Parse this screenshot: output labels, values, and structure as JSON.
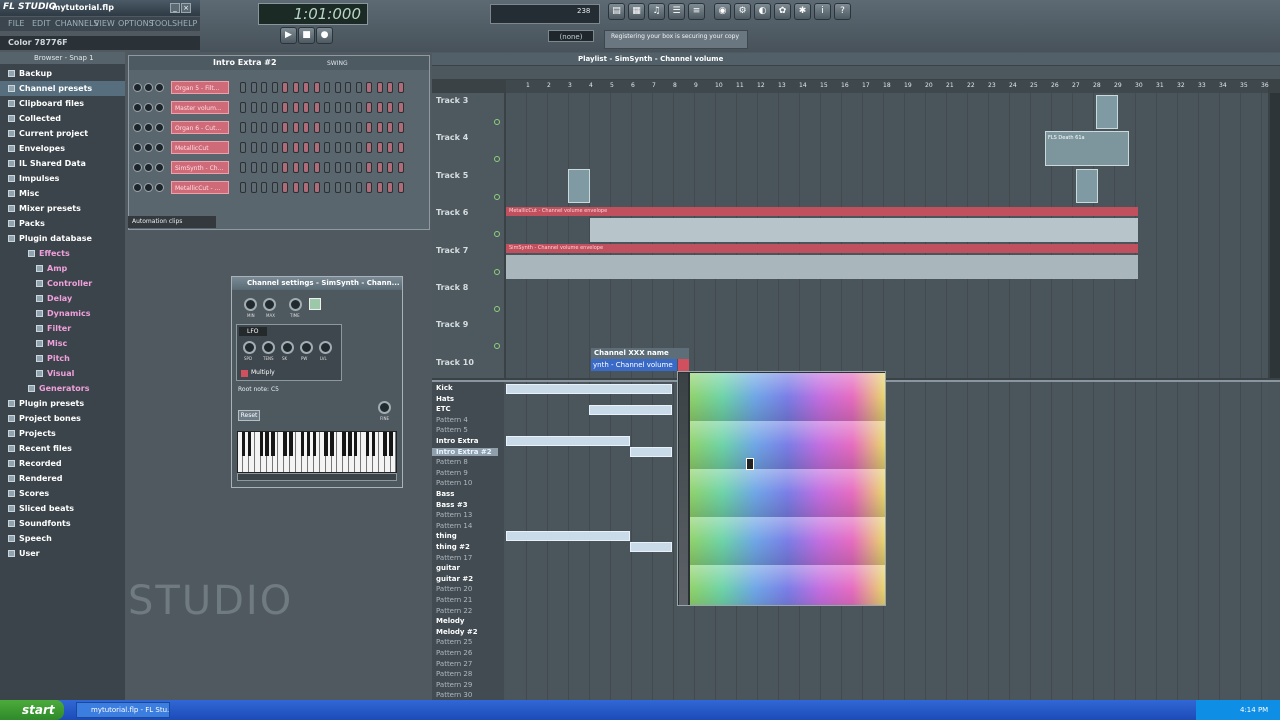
{
  "app": {
    "logo": "FL STUDIO",
    "file_name": "mytutorial.flp",
    "taskbar_task": "mytutorial.flp - FL Stu...",
    "clock": "4:14 PM",
    "start_label": "start"
  },
  "menu": [
    "FILE",
    "EDIT",
    "CHANNELS",
    "VIEW",
    "OPTIONS",
    "TOOLS",
    "HELP"
  ],
  "hint": "Color 78776F",
  "transport": {
    "time": "1:01:000",
    "pattern_select": "(none)",
    "notice": "Registering your box is securing your copy",
    "tempo": "238"
  },
  "browser": {
    "title": "Browser - Snap 1",
    "items": [
      {
        "label": "Backup",
        "sub": false
      },
      {
        "label": "Channel presets",
        "sub": false,
        "selected": true
      },
      {
        "label": "Clipboard files",
        "sub": false
      },
      {
        "label": "Collected",
        "sub": false
      },
      {
        "label": "Current project",
        "sub": false
      },
      {
        "label": "Envelopes",
        "sub": false
      },
      {
        "label": "IL Shared Data",
        "sub": false
      },
      {
        "label": "Impulses",
        "sub": false
      },
      {
        "label": "Misc",
        "sub": false
      },
      {
        "label": "Mixer presets",
        "sub": false
      },
      {
        "label": "Packs",
        "sub": false
      },
      {
        "label": "Plugin database",
        "sub": false
      },
      {
        "label": "Effects",
        "sub": true,
        "level": 1
      },
      {
        "label": "Amp",
        "sub": true,
        "level": 2
      },
      {
        "label": "Controller",
        "sub": true,
        "level": 2
      },
      {
        "label": "Delay",
        "sub": true,
        "level": 2
      },
      {
        "label": "Dynamics",
        "sub": true,
        "level": 2
      },
      {
        "label": "Filter",
        "sub": true,
        "level": 2
      },
      {
        "label": "Misc",
        "sub": true,
        "level": 2
      },
      {
        "label": "Pitch",
        "sub": true,
        "level": 2
      },
      {
        "label": "Visual",
        "sub": true,
        "level": 2
      },
      {
        "label": "Generators",
        "sub": true,
        "level": 1
      },
      {
        "label": "Plugin presets",
        "sub": false
      },
      {
        "label": "Project bones",
        "sub": false
      },
      {
        "label": "Projects",
        "sub": false
      },
      {
        "label": "Recent files",
        "sub": false
      },
      {
        "label": "Recorded",
        "sub": false
      },
      {
        "label": "Rendered",
        "sub": false
      },
      {
        "label": "Scores",
        "sub": false
      },
      {
        "label": "Sliced beats",
        "sub": false
      },
      {
        "label": "Soundfonts",
        "sub": false
      },
      {
        "label": "Speech",
        "sub": false
      },
      {
        "label": "User",
        "sub": false
      }
    ]
  },
  "step_sequencer": {
    "pattern": "Intro Extra #2",
    "swing_label": "SWING",
    "automation_label": "Automation clips",
    "channels": [
      "Organ 5 - Filt...",
      "Master volum...",
      "Organ 6 - Cut...",
      "MetallicCut",
      "SimSynth - Ch...",
      "MetallicCut - ..."
    ]
  },
  "channel_settings": {
    "title": "Channel settings - SimSynth - Chann...",
    "knob_labels": [
      "MIN",
      "MAX",
      "TIME"
    ],
    "lfo_label": "LFO",
    "lfo_knobs": [
      "SPD",
      "TENS",
      "SK",
      "PW",
      "LVL"
    ],
    "multiply_label": "Multiply",
    "root_note": "Root note: C5",
    "reset_label": "Reset",
    "fine_label": "FINE"
  },
  "watermark": "STUDIO",
  "playlist": {
    "title": "Playlist - SimSynth - Channel volume",
    "ruler": [
      "1",
      "2",
      "3",
      "4",
      "5",
      "6",
      "7",
      "8",
      "9",
      "10",
      "11",
      "12",
      "13",
      "14",
      "15",
      "16",
      "17",
      "18",
      "19",
      "20",
      "21",
      "22",
      "23",
      "24",
      "25",
      "26",
      "27",
      "28",
      "29",
      "30",
      "31",
      "32",
      "33",
      "34",
      "35",
      "36"
    ],
    "tracks": [
      "Track 3",
      "Track 4",
      "Track 5",
      "Track 6",
      "Track 7",
      "Track 8",
      "Track 9",
      "Track 10"
    ],
    "clip_labels": {
      "flsdeath": "FLS Death 61a",
      "env6": "MetallicCut - Channel volume envelope",
      "env7": "SimSynth - Channel volume envelope"
    },
    "patterns": [
      {
        "label": "Kick",
        "bold": true
      },
      {
        "label": "Hats",
        "bold": true
      },
      {
        "label": "ETC",
        "bold": true
      },
      {
        "label": "Pattern 4",
        "bold": false
      },
      {
        "label": "Pattern 5",
        "bold": false
      },
      {
        "label": "Intro Extra",
        "bold": true
      },
      {
        "label": "Intro Extra #2",
        "bold": true,
        "selected": true
      },
      {
        "label": "Pattern 8",
        "bold": false
      },
      {
        "label": "Pattern 9",
        "bold": false
      },
      {
        "label": "Pattern 10",
        "bold": false
      },
      {
        "label": "Bass",
        "bold": true
      },
      {
        "label": "Bass #3",
        "bold": true
      },
      {
        "label": "Pattern 13",
        "bold": false
      },
      {
        "label": "Pattern 14",
        "bold": false
      },
      {
        "label": "thing",
        "bold": true
      },
      {
        "label": "thing #2",
        "bold": true
      },
      {
        "label": "Pattern 17",
        "bold": false
      },
      {
        "label": "guitar",
        "bold": true
      },
      {
        "label": "guitar #2",
        "bold": true
      },
      {
        "label": "Pattern 20",
        "bold": false
      },
      {
        "label": "Pattern 21",
        "bold": false
      },
      {
        "label": "Pattern 22",
        "bold": false
      },
      {
        "label": "Melody",
        "bold": true
      },
      {
        "label": "Melody #2",
        "bold": true
      },
      {
        "label": "Pattern 25",
        "bold": false
      },
      {
        "label": "Pattern 26",
        "bold": false
      },
      {
        "label": "Pattern 27",
        "bold": false
      },
      {
        "label": "Pattern 28",
        "bold": false
      },
      {
        "label": "Pattern 29",
        "bold": false
      },
      {
        "label": "Pattern 30",
        "bold": false
      }
    ]
  },
  "context_menu": {
    "header": "Channel XXX name",
    "selected": "ynth - Channel volume"
  },
  "colors": {
    "channel_button": "#cf6a78",
    "menu_highlight": "#3a6ac8",
    "taskbar": "#2a5fcf",
    "browser_sub": "#f0a0dc"
  }
}
